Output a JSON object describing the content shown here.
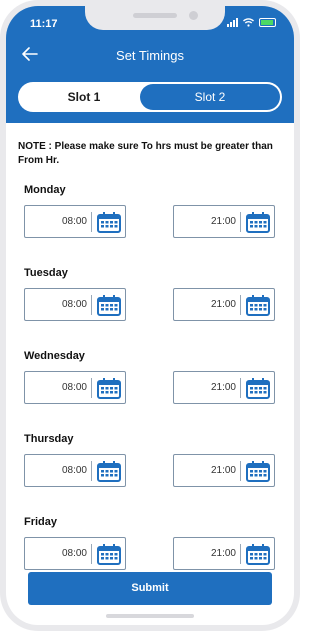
{
  "status_bar": {
    "time": "11:17"
  },
  "header": {
    "back_icon": "arrow-left-icon",
    "title": "Set Timings"
  },
  "tabs": [
    {
      "label": "Slot 1",
      "active": false
    },
    {
      "label": "Slot 2",
      "active": true
    }
  ],
  "note": "NOTE : Please make sure To hrs must be greater than From Hr.",
  "days": [
    {
      "name": "Monday",
      "from": "08:00",
      "to": "21:00"
    },
    {
      "name": "Tuesday",
      "from": "08:00",
      "to": "21:00"
    },
    {
      "name": "Wednesday",
      "from": "08:00",
      "to": "21:00"
    },
    {
      "name": "Thursday",
      "from": "08:00",
      "to": "21:00"
    },
    {
      "name": "Friday",
      "from": "08:00",
      "to": "21:00"
    }
  ],
  "submit_label": "Submit",
  "colors": {
    "brand_blue": "#1f6fbf",
    "field_border": "#7f93a8"
  }
}
